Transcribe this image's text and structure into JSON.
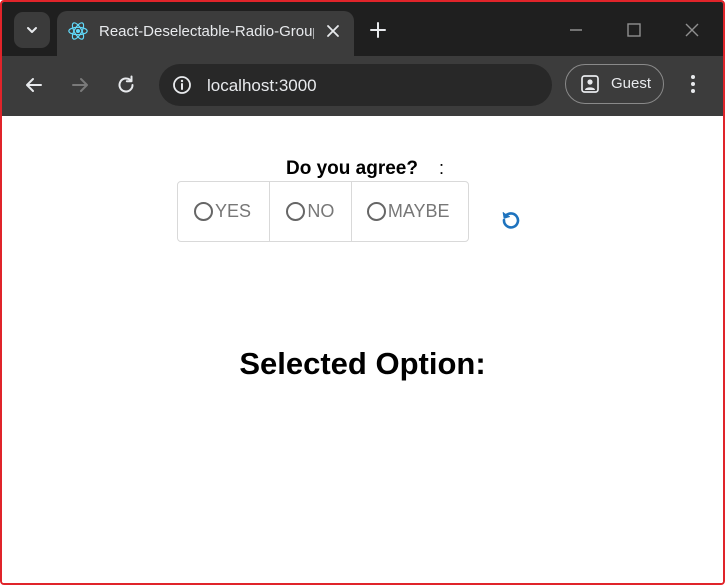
{
  "browser": {
    "tab": {
      "title": "React-Deselectable-Radio-Group"
    },
    "address_bar": {
      "url": "localhost:3000"
    },
    "profile": {
      "label": "Guest"
    }
  },
  "page": {
    "question": "Do you agree?",
    "separator": ":",
    "options": [
      {
        "label": "YES",
        "selected": false
      },
      {
        "label": "NO",
        "selected": false
      },
      {
        "label": "MAYBE",
        "selected": false
      }
    ],
    "selected_heading": "Selected Option:"
  },
  "colors": {
    "accent": "#1e73be",
    "frame_border": "#e0242a",
    "tabstrip_bg": "#1f1f1f",
    "toolbar_bg": "#3c3c3c"
  }
}
